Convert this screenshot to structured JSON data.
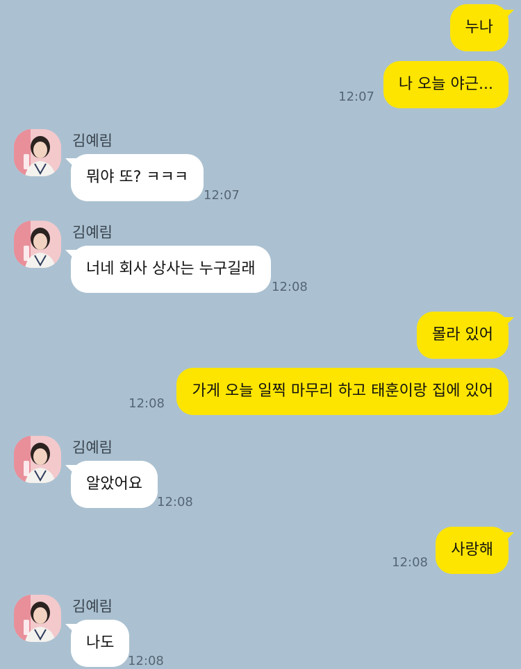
{
  "colors": {
    "background": "#abc1d1",
    "my_bubble": "#fee500",
    "their_bubble": "#ffffff",
    "time_text": "#556575"
  },
  "contact": {
    "name": "김예림",
    "avatar_icon": "profile-photo"
  },
  "messages": [
    {
      "from": "me",
      "text": "누나",
      "time": ""
    },
    {
      "from": "me",
      "text": "나 오늘 야근...",
      "time": "12:07"
    },
    {
      "from": "them",
      "sender": "김예림",
      "text": "뭐야 또? ㅋㅋㅋ",
      "time": "12:07"
    },
    {
      "from": "them",
      "sender": "김예림",
      "text": "너네 회사 상사는 누구길래",
      "time": "12:08"
    },
    {
      "from": "me",
      "text": "몰라 있어",
      "time": ""
    },
    {
      "from": "me",
      "text": "가게 오늘 일찍 마무리 하고 태훈이랑 집에 있어",
      "time": "12:08"
    },
    {
      "from": "them",
      "sender": "김예림",
      "text": "알았어요",
      "time": "12:08"
    },
    {
      "from": "me",
      "text": "사랑해",
      "time": "12:08"
    },
    {
      "from": "them",
      "sender": "김예림",
      "text": "나도",
      "time": "12:08"
    }
  ]
}
